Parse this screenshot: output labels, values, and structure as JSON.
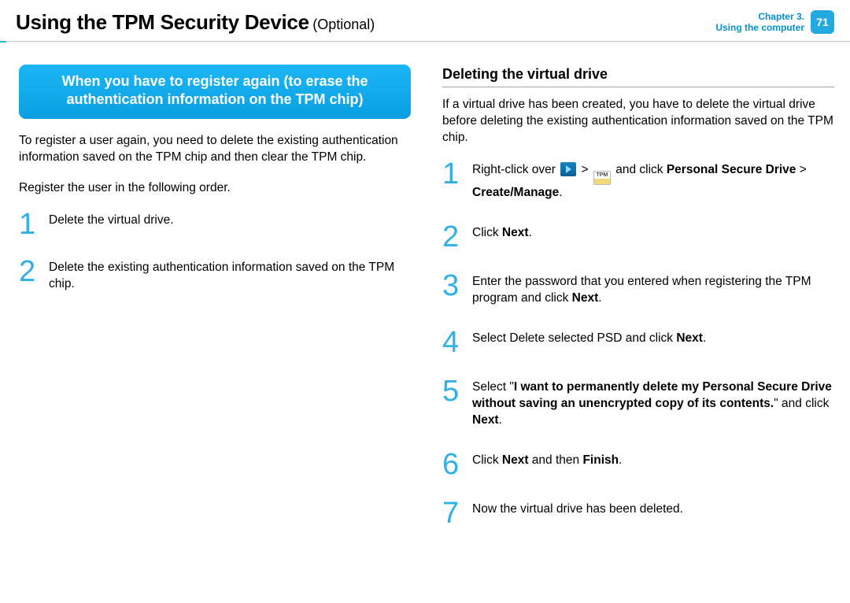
{
  "header": {
    "title": "Using the TPM Security Device",
    "subtitle": "(Optional)",
    "chapter_line1": "Chapter 3.",
    "chapter_line2": "Using the computer",
    "page_number": "71"
  },
  "left": {
    "callout": "When you have to register again (to erase the authentication information on the TPM chip)",
    "para1": "To register a user again, you need to delete the existing authentication information saved on the TPM chip and then clear the TPM chip.",
    "para2": "Register the user in the following order.",
    "steps": [
      {
        "num": "1",
        "text": "Delete the virtual drive."
      },
      {
        "num": "2",
        "text": "Delete the existing authentication information saved on the TPM chip."
      }
    ]
  },
  "right": {
    "heading": "Deleting the virtual drive",
    "intro": "If a virtual drive has been created, you have to delete the virtual drive before deleting the existing authentication information saved on the TPM chip.",
    "steps": [
      {
        "num": "1",
        "parts": {
          "a": "Right-click over ",
          "b": " > ",
          "c": " and click ",
          "d": "Personal Secure Drive",
          "e": " > ",
          "f": "Create/Manage",
          "g": "."
        }
      },
      {
        "num": "2",
        "parts": {
          "a": "Click ",
          "b": "Next",
          "c": "."
        }
      },
      {
        "num": "3",
        "parts": {
          "a": "Enter the password that you entered when registering the TPM program and click ",
          "b": "Next",
          "c": "."
        }
      },
      {
        "num": "4",
        "parts": {
          "a": "Select Delete selected PSD and click ",
          "b": "Next",
          "c": "."
        }
      },
      {
        "num": "5",
        "parts": {
          "a": "Select \"",
          "b": "I want to permanently delete my Personal Secure Drive without saving an unencrypted copy of its contents.",
          "c": "\" and click ",
          "d": "Next",
          "e": "."
        }
      },
      {
        "num": "6",
        "parts": {
          "a": "Click ",
          "b": "Next",
          "c": " and then ",
          "d": "Finish",
          "e": "."
        }
      },
      {
        "num": "7",
        "parts": {
          "a": "Now the virtual drive has been deleted."
        }
      }
    ]
  },
  "icons": {
    "tpm_label": "TPM"
  }
}
